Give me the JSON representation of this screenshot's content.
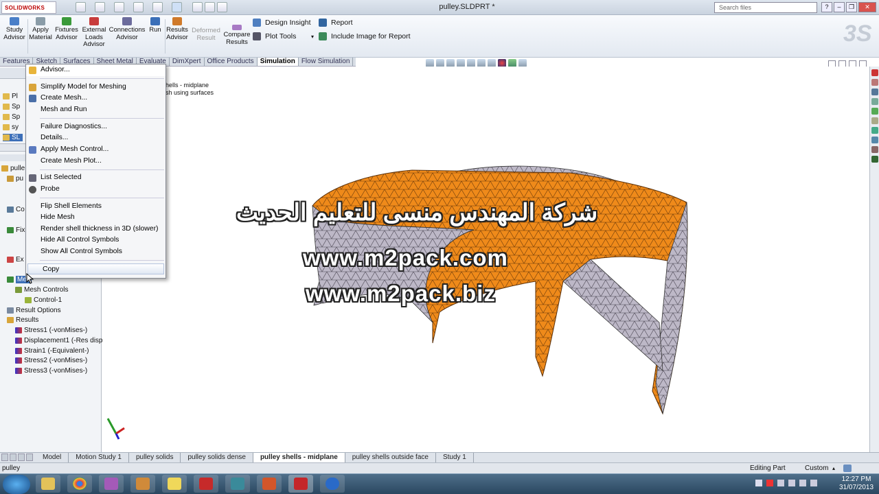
{
  "app": {
    "logo": "SOLIDWORKS",
    "doc_title": "pulley.SLDPRT *",
    "search_placeholder": "Search files"
  },
  "command_manager": {
    "buttons": [
      "Study Advisor",
      "Apply Material",
      "Fixtures Advisor",
      "External Loads Advisor",
      "Connections Advisor",
      "Run",
      "Results Advisor",
      "Deformed Result",
      "Compare Results"
    ],
    "right_items": [
      "Design Insight",
      "Plot Tools",
      "Report",
      "Include Image for Report"
    ]
  },
  "tabs": [
    "Features",
    "Sketch",
    "Surfaces",
    "Sheet Metal",
    "Evaluate",
    "DimXpert",
    "Office Products",
    "Simulation",
    "Flow Simulation"
  ],
  "active_tab": "Simulation",
  "tree": {
    "top_items": [
      "Pl",
      "Sp",
      "Sp",
      "sy",
      "SL"
    ],
    "items": [
      "pulle",
      "pu",
      "Co",
      "Fix",
      "Ex",
      "Mes",
      "Mesh Controls",
      "Control-1",
      "Result Options",
      "Results",
      "Stress1 (-vonMises-)",
      "Displacement1 (-Res disp",
      "Strain1 (-Equivalent-)",
      "Stress2 (-vonMises-)",
      "Stress3 (-vonMises-)"
    ]
  },
  "graphics": {
    "info_line1": "hells - midplane",
    "info_line2": "sh using surfaces"
  },
  "context_menu": {
    "items": [
      "Advisor...",
      "Simplify Model for Meshing",
      "Create Mesh...",
      "Mesh and Run",
      "Failure Diagnostics...",
      "Details...",
      "Apply Mesh Control...",
      "Create Mesh Plot...",
      "List Selected",
      "Probe",
      "Flip Shell Elements",
      "Hide Mesh",
      "Render shell thickness in 3D (slower)",
      "Hide All Control Symbols",
      "Show All Control Symbols",
      "Copy"
    ]
  },
  "watermark": {
    "arabic": "شركة المهندس منسى للتعليم الحديث",
    "line1": "www.m2pack.com",
    "line2": "www.m2pack.biz"
  },
  "bottom_tabs": [
    "Model",
    "Motion Study 1",
    "pulley solids",
    "pulley solids dense",
    "pulley shells - midplane",
    "pulley shells outside face",
    "Study 1"
  ],
  "active_bottom_tab": "pulley shells - midplane",
  "status": {
    "left": "pulley",
    "mode": "Editing Part",
    "units": "Custom"
  },
  "taskbar": {
    "time": "12:27 PM",
    "date": "31/07/2013"
  },
  "colors": {
    "mesh_orange": "#ef8a1a",
    "mesh_gray": "#b9b3c4",
    "accent": "#1a4fa0"
  }
}
